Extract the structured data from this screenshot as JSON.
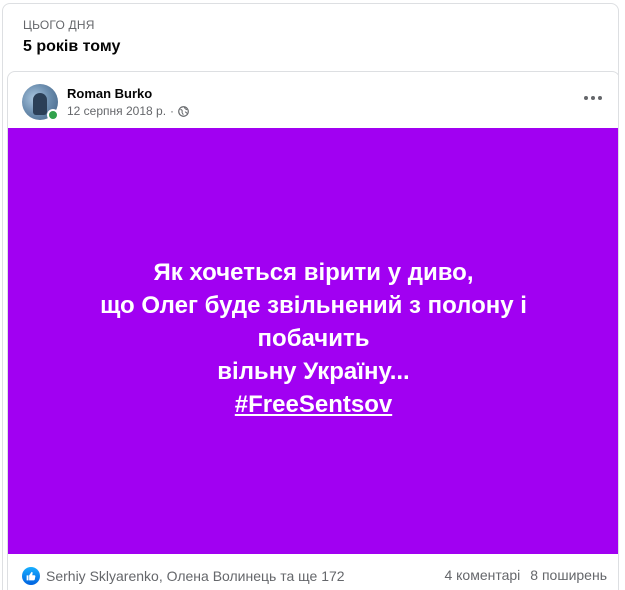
{
  "memory": {
    "kicker": "ЦЬОГО ДНЯ",
    "title": "5 років тому"
  },
  "post": {
    "author": "Roman Burko",
    "date": "12 серпня 2018 р.",
    "date_separator": "·",
    "audience_icon": "globe-icon",
    "more_icon": "more-options-icon",
    "image_background": "#a100f2",
    "text_lines": [
      "Як хочеться вірити у диво,",
      "що Олег буде звільнений з полону і",
      "побачить",
      "вільну Україну..."
    ],
    "hashtag": "#FreeSentsov"
  },
  "footer": {
    "reaction_icon": "like-icon",
    "reactions_text": "Serhiy Sklyarenko, Олена Волинець та ще 172",
    "comments": "4 коментарі",
    "shares": "8 поширень"
  },
  "colors": {
    "accent": "#1877f2",
    "presence": "#31a24c",
    "muted_text": "#65676b"
  }
}
